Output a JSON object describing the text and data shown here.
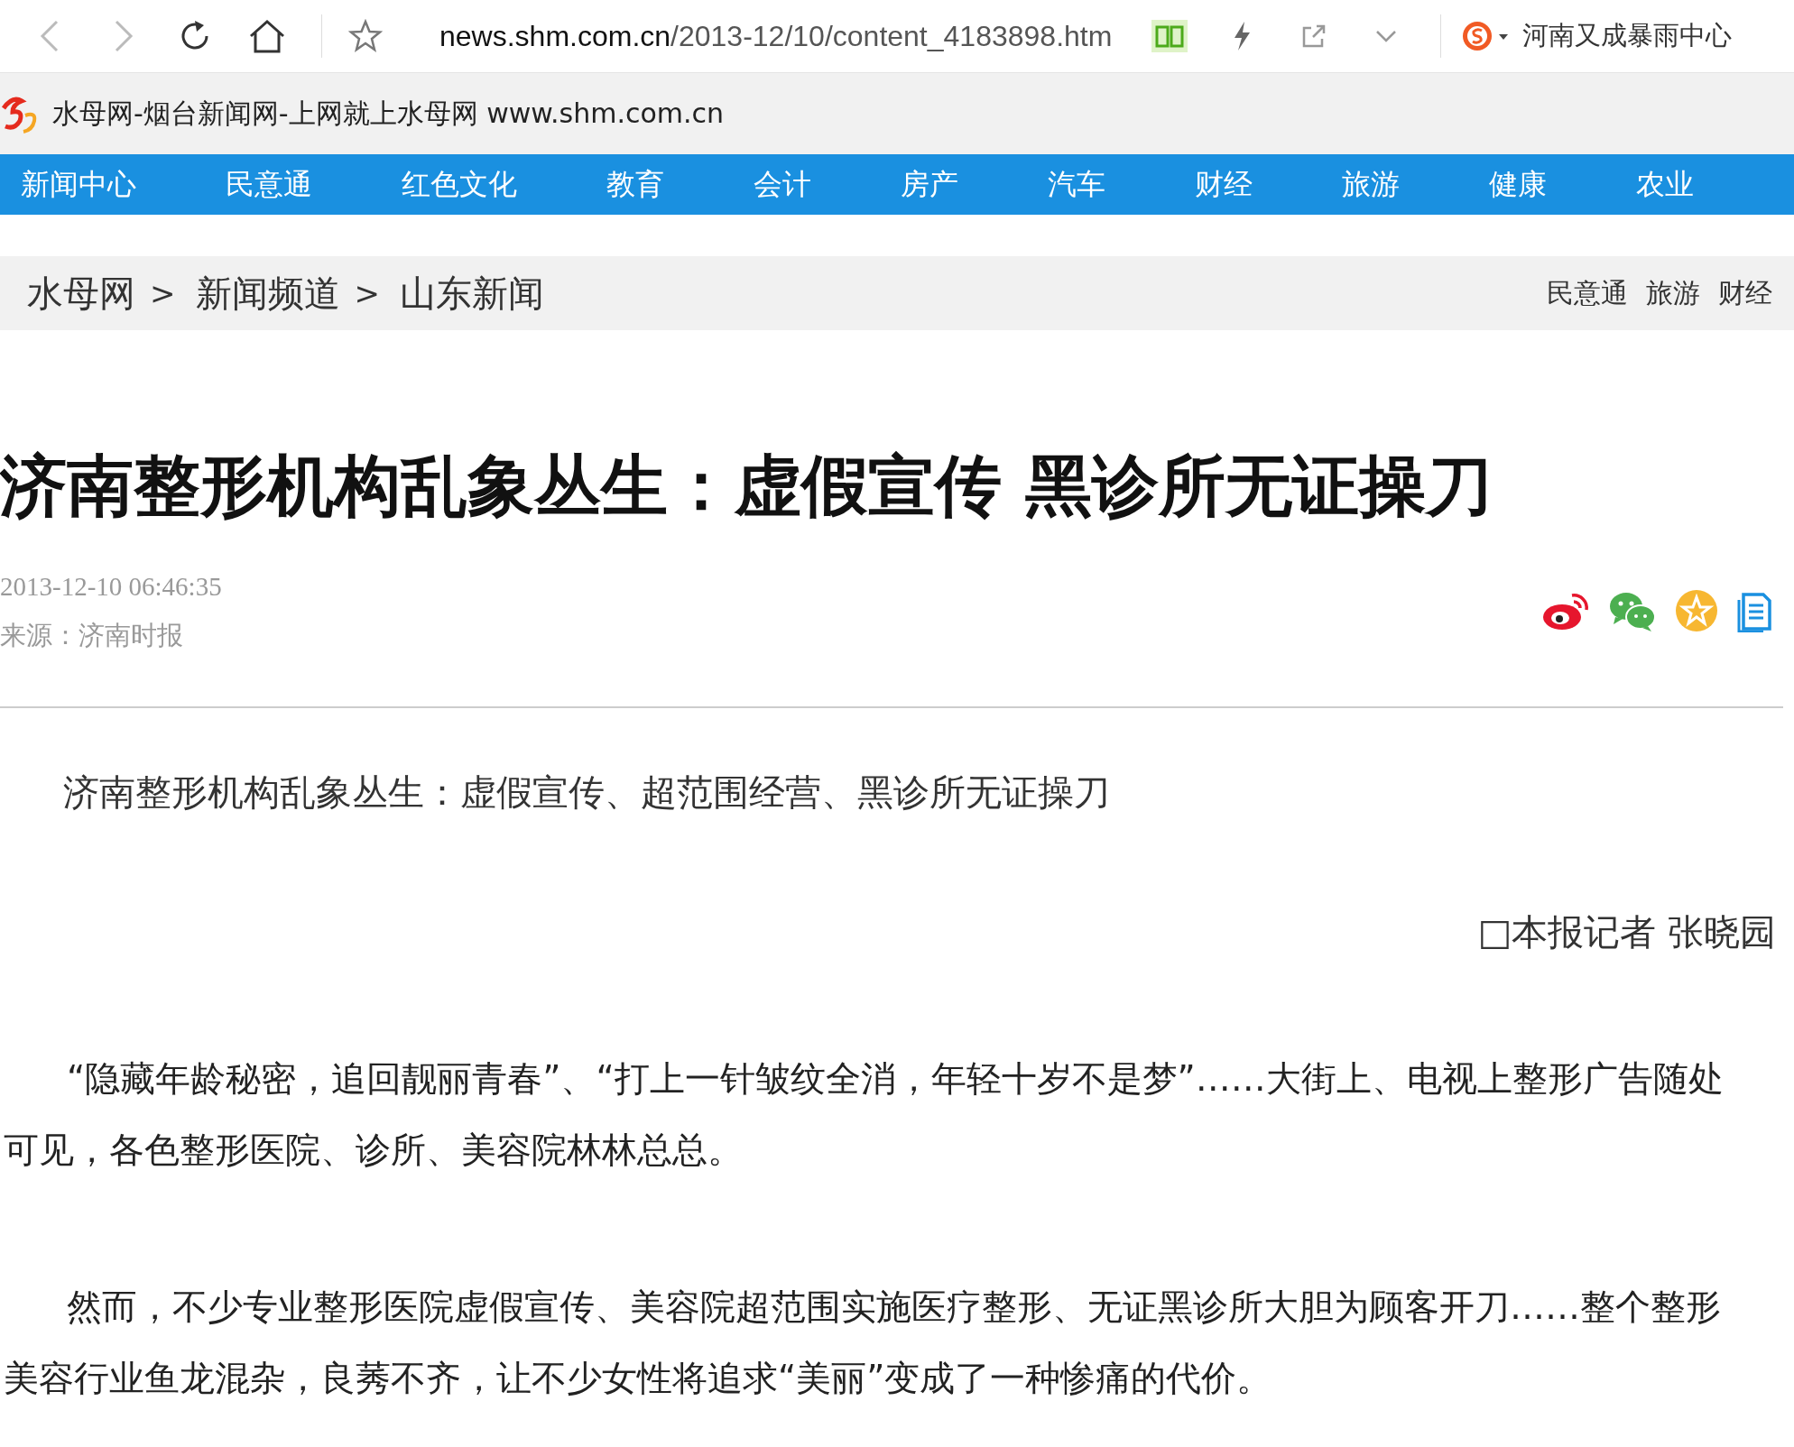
{
  "browser": {
    "url_host": "news.shm.com.cn",
    "url_path": "/2013-12/10/content_4183898.htm",
    "search_text": "河南又成暴雨中心"
  },
  "tab": {
    "title": "水母网-烟台新闻网-上网就上水母网 www.shm.com.cn"
  },
  "nav": {
    "items": [
      "新闻中心",
      "民意通",
      "红色文化",
      "教育",
      "会计",
      "房产",
      "汽车",
      "财经",
      "旅游",
      "健康",
      "农业"
    ]
  },
  "breadcrumb": {
    "items": [
      {
        "kind": "link",
        "text": "水母网"
      },
      {
        "kind": "separator",
        "text": ">"
      },
      {
        "kind": "link",
        "text": "新闻频道"
      },
      {
        "kind": "separator",
        "text": ">"
      },
      {
        "kind": "link",
        "text": "山东新闻"
      }
    ]
  },
  "quick_links": [
    "民意通",
    "旅游",
    "财经"
  ],
  "article": {
    "title": "济南整形机构乱象丛生：虚假宣传 黑诊所无证操刀",
    "date": "2013-12-10 06:46:35",
    "source": "来源：济南时报",
    "lead": "济南整形机构乱象丛生：虚假宣传、超范围经营、黑诊所无证操刀",
    "byline": "□本报记者 张晓园",
    "paragraphs": [
      "“隐藏年龄秘密，追回靓丽青春”、“打上一针皱纹全消，年轻十岁不是梦”……大街上、电视上整形广告随处可见，各色整形医院、诊所、美容院林林总总。",
      "然而，不少专业整形医院虚假宣传、美容院超范围实施医疗整形、无证黑诊所大胆为顾客开刀……整个整形美容行业鱼龙混杂，良莠不齐，让不少女性将追求“美丽”变成了一种惨痛的代价。"
    ]
  }
}
